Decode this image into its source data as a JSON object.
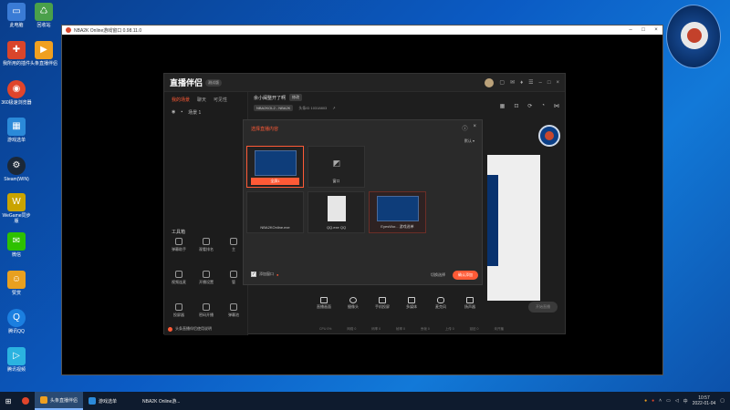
{
  "desktop": {
    "icons": [
      {
        "label": "此电脑",
        "icon": "computer-icon",
        "color": "#3a7bd5"
      },
      {
        "label": "回收站",
        "icon": "recycle-bin-icon",
        "color": "#4aa04a"
      },
      {
        "label": "我所用的插件",
        "icon": "plugin-icon",
        "color": "#d9452b"
      },
      {
        "label": "头条直播伴侣",
        "icon": "live-companion-icon",
        "color": "#f0a020"
      },
      {
        "label": "360极速浏览器",
        "icon": "browser-icon",
        "color": "#e0452b"
      },
      {
        "label": "游戏选单",
        "icon": "game-menu-icon",
        "color": "#2b8ad9"
      },
      {
        "label": "Steam(WIN)",
        "icon": "steam-icon",
        "color": "#1b2838"
      },
      {
        "label": "WeGame同步版",
        "icon": "wegame-icon",
        "color": "#c9a400"
      },
      {
        "label": "微信",
        "icon": "wechat-icon",
        "color": "#2dc100"
      },
      {
        "label": "赞赏",
        "icon": "reward-icon",
        "color": "#e8a020"
      },
      {
        "label": "腾讯QQ",
        "icon": "qq-icon",
        "color": "#1b7fe0"
      },
      {
        "label": "腾讯视频",
        "icon": "video-icon",
        "color": "#2bb3e0"
      }
    ]
  },
  "window": {
    "title": "NBA2K Online游戏窗口 0.98.11.0"
  },
  "app": {
    "brand": "直播伴侣",
    "beta": "测试版",
    "tabs": [
      "我的场景",
      "聊天",
      "可见性"
    ],
    "scene_label": "场景 1",
    "stream_title": "余小闽整开了啊",
    "edit_label": "修改",
    "game_tag": "NBA2KOL2 - NBA2K",
    "meta_text": "头条ID  10318803",
    "tools_title": "工具箱",
    "tools": [
      {
        "label": "弹幕助手"
      },
      {
        "label": "观看排名"
      },
      {
        "label": "主"
      },
      {
        "label": "视频连麦"
      },
      {
        "label": "开播设置"
      },
      {
        "label": "管"
      },
      {
        "label": "投屏器"
      },
      {
        "label": "密码开播"
      },
      {
        "label": "弹幕池"
      },
      {
        "label": "开播"
      },
      {
        "label": "提醒"
      },
      {
        "label": ""
      }
    ],
    "bottom_note": "头条直播伴侣使用说明",
    "dialog": {
      "title": "选择直播内容",
      "sort": "默认",
      "tiles": [
        {
          "label": "全屏1"
        },
        {
          "label": "窗口"
        },
        {
          "label": "NBA2KOnline.exe"
        },
        {
          "label": "QQ.exe    QQ"
        },
        {
          "label": "EyesWor...    游戏选单"
        }
      ],
      "checkbox_label": "添加窗口",
      "cancel_label": "切换选择",
      "add_label": "确认添加"
    },
    "toolbar": [
      "直播画面",
      "摄像头",
      "手机投屏",
      "多媒体",
      "麦克风",
      "扬声器"
    ],
    "go_live": "开始直播",
    "status": [
      "CPU 0%",
      "网络 0",
      "码率 0",
      "帧率 0",
      "丢帧 0",
      "上传 0",
      "延迟 0",
      "未开播"
    ]
  },
  "taskbar": {
    "items": [
      {
        "label": "头条直播伴侣",
        "active": true,
        "color": "#f0a020"
      },
      {
        "label": "游戏选单",
        "active": false,
        "color": "#2b8ad9"
      },
      {
        "label": "NBA2K Online游...",
        "active": false,
        "color": "#333333"
      }
    ],
    "time": "10:57",
    "date": "2022-01-04"
  }
}
